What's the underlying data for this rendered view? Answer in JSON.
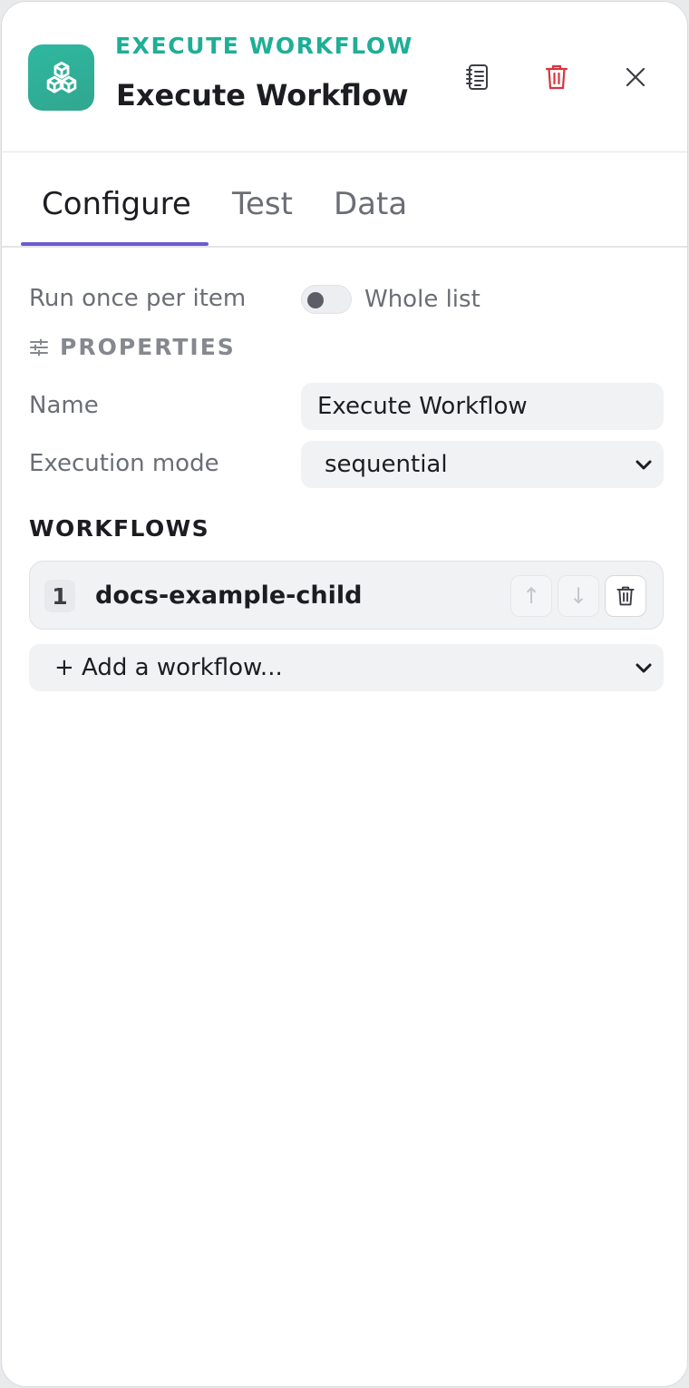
{
  "header": {
    "node_type": "EXECUTE WORKFLOW",
    "title": "Execute Workflow",
    "icons": {
      "node": "cubes-icon",
      "docs": "document-list-icon",
      "delete": "trash-icon",
      "close": "close-icon"
    },
    "accent_color": "#1fae96",
    "delete_color": "#d8343f"
  },
  "tabs": [
    {
      "label": "Configure",
      "active": true
    },
    {
      "label": "Test",
      "active": false
    },
    {
      "label": "Data",
      "active": false
    }
  ],
  "tab_accent_color": "#6a5ccf",
  "run_mode": {
    "label": "Run once per item",
    "toggle_label": "Whole list",
    "toggle_on": false
  },
  "properties": {
    "heading": "PROPERTIES",
    "name_label": "Name",
    "name_value": "Execute Workflow",
    "mode_label": "Execution mode",
    "mode_value": "sequential"
  },
  "workflows": {
    "heading": "WORKFLOWS",
    "items": [
      {
        "index": "1",
        "name": "docs-example-child"
      }
    ],
    "move_up": "↑",
    "move_down": "↓",
    "add_placeholder": "+ Add a workflow..."
  }
}
